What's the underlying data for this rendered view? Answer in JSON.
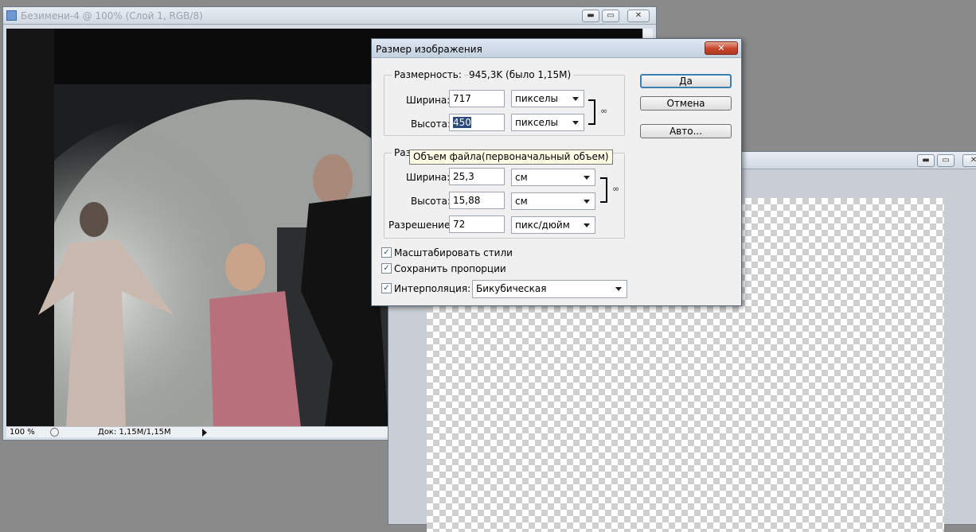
{
  "doc_window": {
    "title": "Безимени-4 @ 100% (Слой 1, RGB/8)",
    "zoom": "100 %",
    "doc_info": "Док: 1,15M/1,15M"
  },
  "dialog": {
    "title": "Размер изображения",
    "close_glyph": "✕",
    "pixel_dims": {
      "caption": "Размерность:",
      "value": "945,3K (было 1,15M)",
      "width_label": "Ширина:",
      "width_value": "717",
      "width_unit": "пикселы",
      "height_label": "Высота:",
      "height_value": "450",
      "height_unit": "пикселы"
    },
    "doc_size": {
      "caption": "Разм",
      "width_label": "Ширина:",
      "width_value": "25,3",
      "width_unit": "см",
      "height_label": "Высота:",
      "height_value": "15,88",
      "height_unit": "см",
      "resolution_label": "Разрешение:",
      "resolution_value": "72",
      "resolution_unit": "пикс/дюйм"
    },
    "tooltip": "Объем файла(первоначальный объем)",
    "checkboxes": {
      "scale_styles": {
        "label": "Масштабировать стили",
        "checked": true
      },
      "constrain": {
        "label": "Сохранить пропорции",
        "checked": true
      },
      "resample": {
        "label": "Интерполяция:",
        "checked": true,
        "method": "Бикубическая"
      }
    },
    "buttons": {
      "ok": "Да",
      "cancel": "Отмена",
      "auto": "Авто..."
    }
  },
  "window_controls": {
    "minimize": "▬",
    "restore": "▭",
    "close": "✕"
  },
  "icons": {
    "chain": "link-icon",
    "check": "✓"
  }
}
